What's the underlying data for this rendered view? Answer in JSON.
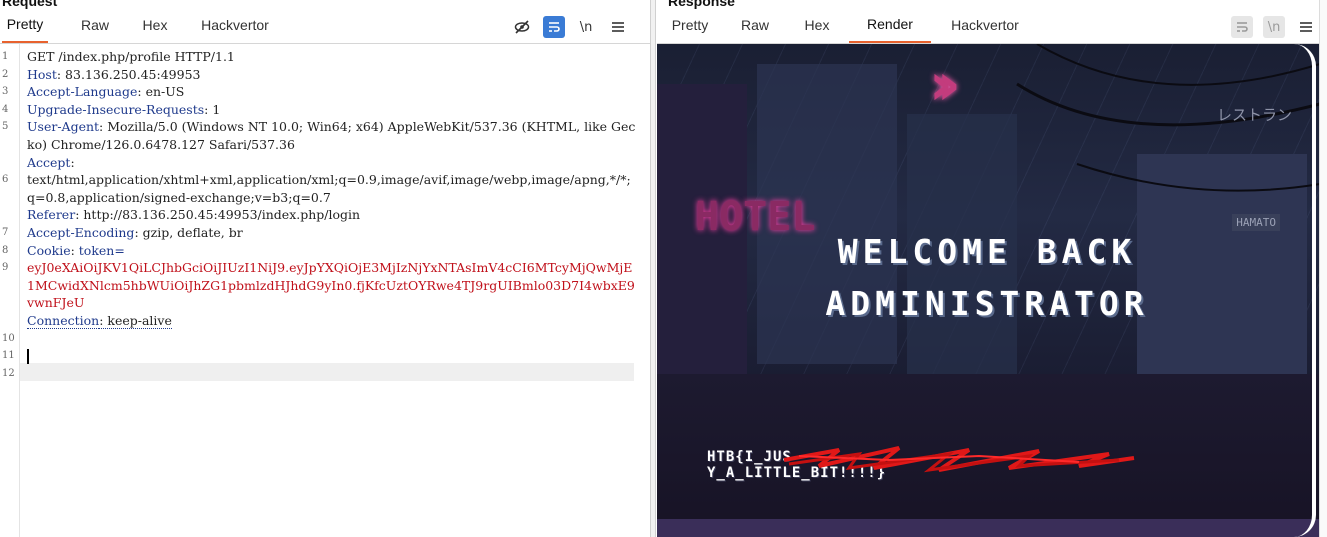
{
  "request": {
    "title": "Request",
    "tabs": [
      {
        "label": "Pretty",
        "active": true
      },
      {
        "label": "Raw",
        "active": false
      },
      {
        "label": "Hex",
        "active": false
      },
      {
        "label": "Hackvertor",
        "active": false
      }
    ],
    "tools": {
      "hide_icon": "eye-off-icon",
      "wrap_icon": "wrap-lines-icon",
      "newline_label": "\\n",
      "menu_icon": "menu-icon"
    },
    "line_numbers": [
      "1",
      "2",
      "3",
      "4",
      "5",
      "",
      "",
      "6",
      "",
      "",
      "7",
      "8",
      "9",
      "",
      "",
      "",
      "10",
      "11",
      "12"
    ],
    "lines": {
      "l1": "GET /index.php/profile HTTP/1.1",
      "l2_key": "Host",
      "l2_val": ": 83.136.250.45:49953",
      "l3_key": "Accept-Language",
      "l3_val": ": en-US",
      "l4_key": "Upgrade-Insecure-Requests",
      "l4_val": ": 1",
      "l5_key": "User-Agent",
      "l5_val": ": Mozilla/5.0 (Windows NT 10.0; Win64; x64) AppleWebKit/537.36 (KHTML, like Gecko) Chrome/126.0.6478.127 Safari/537.36",
      "l6_key": "Accept",
      "l6_val": ":",
      "l6_cont": "text/html,application/xhtml+xml,application/xml;q=0.9,image/avif,image/webp,image/apng,*/*;q=0.8,application/signed-exchange;v=b3;q=0.7",
      "l7_key": "Referer",
      "l7_val": ": http://83.136.250.45:49953/index.php/login",
      "l8_key": "Accept-Encoding",
      "l8_val": ": gzip, deflate, br",
      "l9_key": "Cookie",
      "l9_val": ": ",
      "l9_cookie_name": "token=",
      "l9_token": "eyJ0eXAiOiJKV1QiLCJhbGciOiJIUzI1NiJ9.eyJpYXQiOjE3MjIzNjYxNTAsImV4cCI6MTcyMjQwMjE1MCwidXNlcm5hbWUiOiJhZG1pbmlzdHJhdG9yIn0.fjKfcUztOYRwe4TJ9rgUIBmlo03D7I4wbxE9vwnFJeU",
      "l10_key": "Connection",
      "l10_val": ": keep-alive"
    }
  },
  "response": {
    "title": "Response",
    "tabs": [
      {
        "label": "Pretty",
        "active": false
      },
      {
        "label": "Raw",
        "active": false
      },
      {
        "label": "Hex",
        "active": false
      },
      {
        "label": "Render",
        "active": true
      },
      {
        "label": "Hackvertor",
        "active": false
      }
    ],
    "tools": {
      "wrap_icon": "wrap-lines-icon",
      "newline_label": "\\n",
      "menu_icon": "menu-icon"
    },
    "render": {
      "heading_line1": "WELCOME BACK",
      "heading_line2": "ADMINISTRATOR",
      "flag_start": "HTB{I_JUS",
      "flag_end": "Y_A_LITTLE_BIT!!!!}",
      "neon_sign": "HOTEL",
      "jp_sign": "レストラン",
      "hamato": "HAMATO"
    }
  },
  "colors": {
    "accent_tab": "#e8622e",
    "header_key": "#1f3a8c",
    "cookie_value": "#c0101a",
    "toggle_on": "#3a7bd5"
  }
}
